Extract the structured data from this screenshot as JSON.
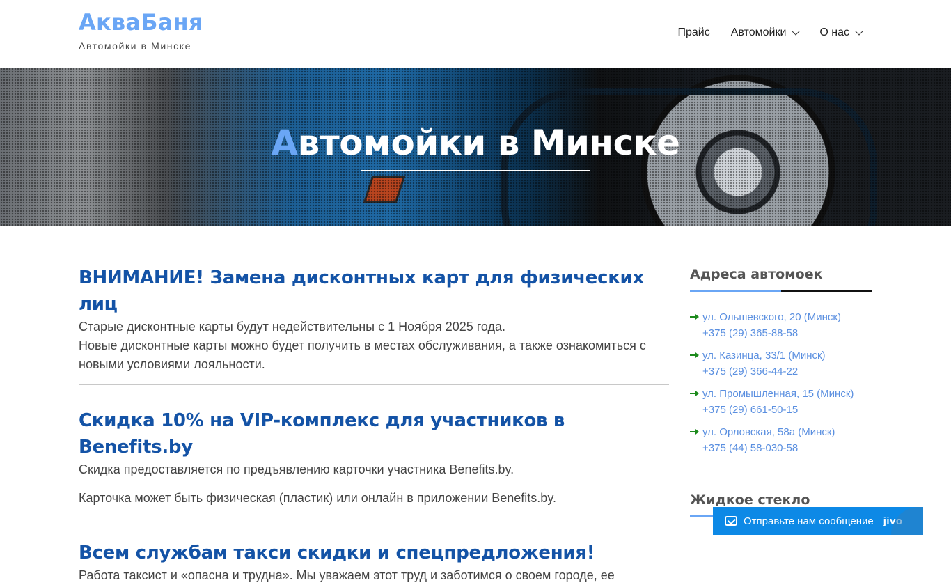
{
  "header": {
    "brand_title": "АкваБаня",
    "brand_subtitle": "Автомойки в Минске",
    "nav": [
      {
        "label": "Прайс",
        "has_dropdown": false
      },
      {
        "label": "Автомойки",
        "has_dropdown": true
      },
      {
        "label": "О нас",
        "has_dropdown": true
      }
    ]
  },
  "hero": {
    "title_first": "А",
    "title_rest": "втомойки в Минске"
  },
  "posts": [
    {
      "title": "ВНИМАНИЕ! Замена дисконтных карт для физических лиц",
      "paragraphs": [
        "Старые дисконтные карты будут недействительны с 1 Ноября 2025 года.",
        "Новые дисконтные карты можно будет получить в местах обслуживания, а также ознакомиться с новыми условиями лояльности."
      ]
    },
    {
      "title": "Скидка 10% на VIP-комплекс для участников в Benefits.by",
      "paragraphs": [
        "Скидка предоставляется по предъявлению карточки участника Benefits.by.",
        "Карточка может быть физическая (пластик) или онлайн в приложении Benefits.by."
      ]
    },
    {
      "title": "Всем службам такси скидки и спецпредложения!",
      "paragraphs": [
        "Работа таксист и «опасна и трудна». Мы уважаем этот труд и заботимся о своем городе, ее"
      ]
    }
  ],
  "sidebar": {
    "addresses_title": "Адреса автомоек",
    "addresses": [
      {
        "address": "ул. Ольшевского, 20 (Минск)",
        "phone": "+375 (29) 365-88-58"
      },
      {
        "address": "ул. Казинца, 33/1 (Минск)",
        "phone": "+375 (29) 366-44-22"
      },
      {
        "address": "ул. Промышленная, 15 (Минск)",
        "phone": "+375 (29) 661-50-15"
      },
      {
        "address": "ул. Орловская, 58а (Минск)",
        "phone": "+375 (44) 58-030-58"
      }
    ],
    "second_title": "Жидкое стекло"
  },
  "chat": {
    "label": "Отправьте нам сообщение",
    "brand": "jivo"
  },
  "colors": {
    "accent": "#6aa6f5",
    "post_title": "#1453a6",
    "chat_bg": "#0d89e6"
  }
}
